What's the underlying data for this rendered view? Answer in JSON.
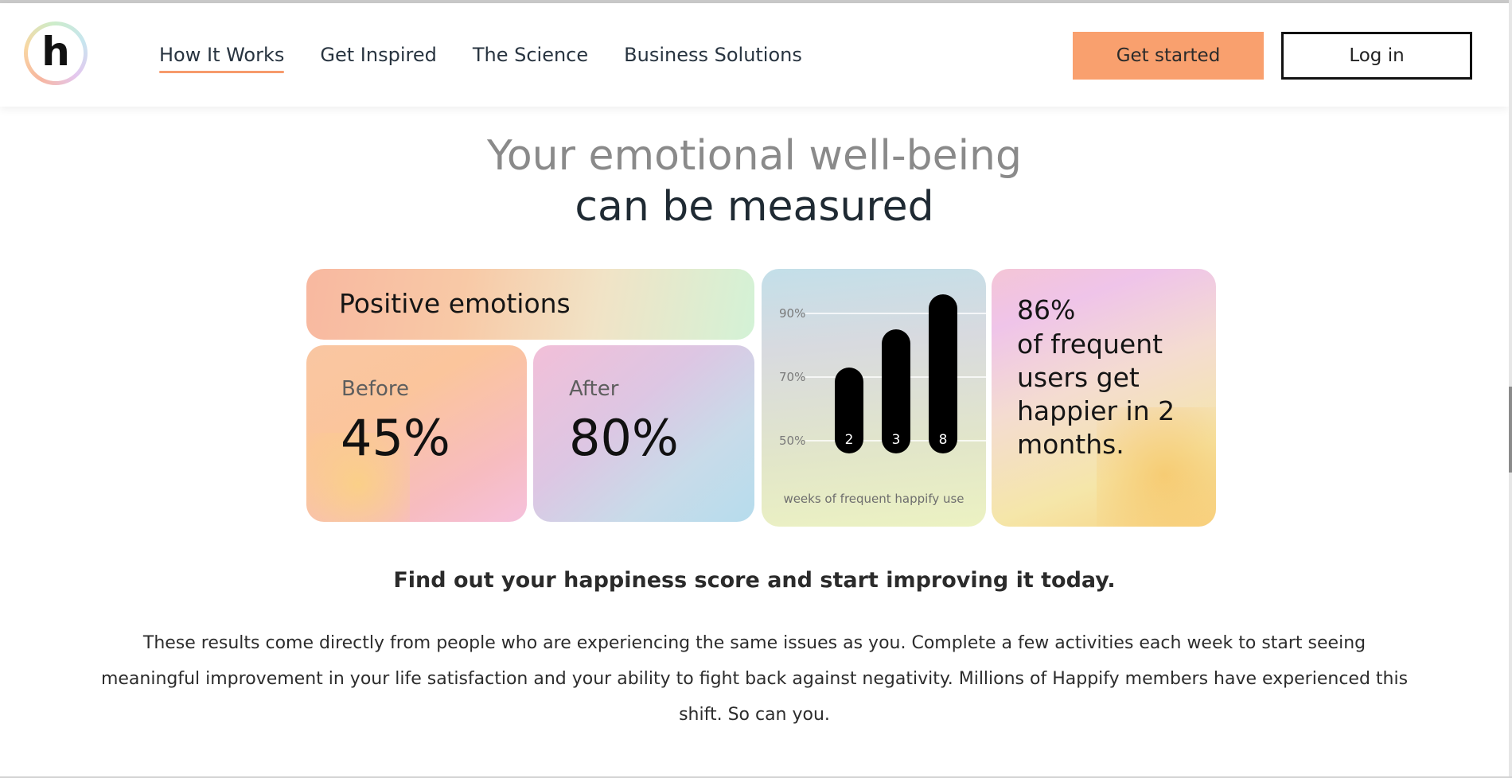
{
  "header": {
    "logo_letter": "h",
    "nav": [
      {
        "label": "How It Works",
        "active": true
      },
      {
        "label": "Get Inspired",
        "active": false
      },
      {
        "label": "The Science",
        "active": false
      },
      {
        "label": "Business Solutions",
        "active": false
      }
    ],
    "get_started_label": "Get started",
    "login_label": "Log in"
  },
  "hero": {
    "line1": "Your emotional well-being",
    "line2": "can be measured"
  },
  "cards": {
    "positive_label": "Positive emotions",
    "before": {
      "label": "Before",
      "value": "45%"
    },
    "after": {
      "label": "After",
      "value": "80%"
    },
    "stat": {
      "percent": "86%",
      "text": "of frequent users get happier in 2 months."
    }
  },
  "chart_data": {
    "type": "bar",
    "categories": [
      "2",
      "3",
      "8"
    ],
    "values": [
      73,
      85,
      96
    ],
    "xlabel": "weeks of frequent happify use",
    "ylabel": "",
    "yticks": [
      "90%",
      "70%",
      "50%"
    ],
    "ylim": [
      45,
      100
    ],
    "grid": true,
    "bar_color": "#000000"
  },
  "footer": {
    "tagline": "Find out your happiness score and start improving it today.",
    "paragraph": "These results come directly from people who are experiencing the same issues as you. Complete a few activities each week to start seeing meaningful improvement in your life satisfaction and your ability to fight back against negativity. Millions of Happify members have experienced this shift. So can you."
  },
  "colors": {
    "accent": "#f9a06e",
    "text": "#1f2a33",
    "muted_heading": "#8a8a8a"
  }
}
